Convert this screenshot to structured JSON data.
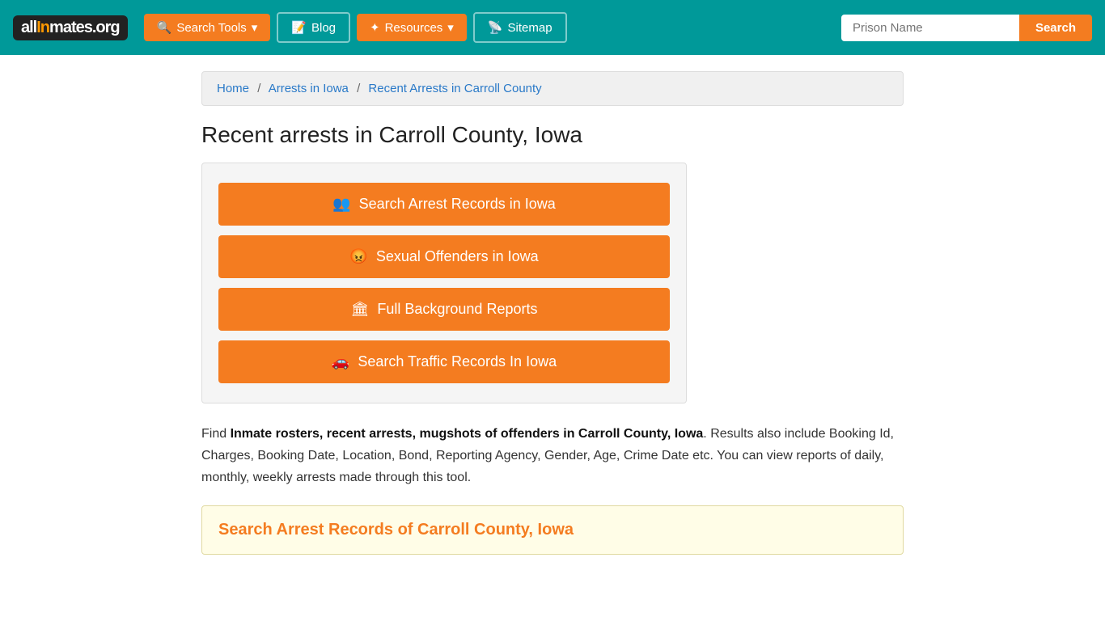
{
  "site": {
    "logo": "all🔒mates.org",
    "logo_parts": {
      "all": "all",
      "in": "In",
      "mates": "mates.",
      "org": "org"
    }
  },
  "nav": {
    "search_tools_label": "Search Tools",
    "blog_label": "Blog",
    "resources_label": "Resources",
    "sitemap_label": "Sitemap",
    "prison_input_placeholder": "Prison Name",
    "search_button_label": "Search"
  },
  "breadcrumb": {
    "home": "Home",
    "arrests_iowa": "Arrests in Iowa",
    "current": "Recent Arrests in Carroll County"
  },
  "page": {
    "title": "Recent arrests in Carroll County, Iowa",
    "buttons": [
      {
        "id": "arrest-records",
        "icon": "👥",
        "label": "Search Arrest Records in Iowa"
      },
      {
        "id": "sexual-offenders",
        "icon": "😡",
        "label": "Sexual Offenders in Iowa"
      },
      {
        "id": "background-reports",
        "icon": "🏛",
        "label": "Full Background Reports"
      },
      {
        "id": "traffic-records",
        "icon": "🚗",
        "label": "Search Traffic Records In Iowa"
      }
    ],
    "description_prefix": "Find ",
    "description_bold": "Inmate rosters, recent arrests, mugshots of offenders in Carroll County, Iowa",
    "description_suffix": ". Results also include Booking Id, Charges, Booking Date, Location, Bond, Reporting Agency, Gender, Age, Crime Date etc. You can view reports of daily, monthly, weekly arrests made through this tool.",
    "search_section_title": "Search Arrest Records of Carroll County, Iowa"
  }
}
